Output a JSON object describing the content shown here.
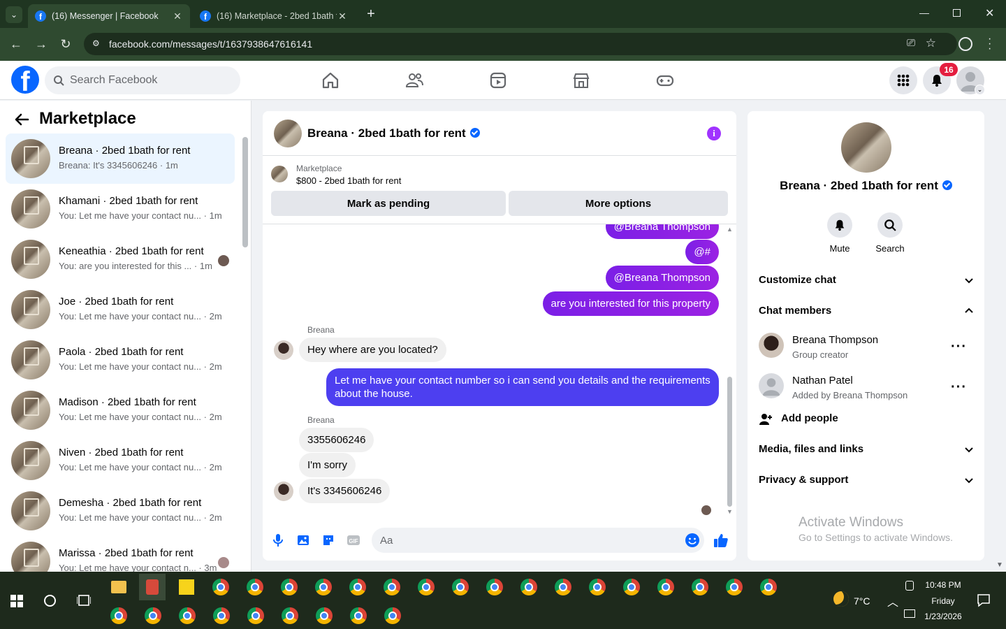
{
  "browser": {
    "tabs": [
      {
        "title": "(16) Messenger | Facebook",
        "active": true
      },
      {
        "title": "(16) Marketplace - 2bed 1bath f",
        "active": false
      }
    ],
    "url": "facebook.com/messages/t/1637938647616141"
  },
  "header": {
    "search_placeholder": "Search Facebook",
    "notification_count": "16"
  },
  "left": {
    "title": "Marketplace",
    "chats": [
      {
        "name": "Breana · 2bed 1bath for rent",
        "preview": "Breana: It's 3345606246 · 1m",
        "selected": true
      },
      {
        "name": "Khamani · 2bed 1bath for rent",
        "preview": "You: Let me have your contact nu...  · 1m"
      },
      {
        "name": "Keneathia · 2bed 1bath for rent",
        "preview": "You: are you interested for this ...  · 1m"
      },
      {
        "name": "Joe · 2bed 1bath for rent",
        "preview": "You: Let me have your contact nu...  · 2m"
      },
      {
        "name": "Paola · 2bed 1bath for rent",
        "preview": "You: Let me have your contact nu...  · 2m"
      },
      {
        "name": "Madison · 2bed 1bath for rent",
        "preview": "You: Let me have your contact nu...  · 2m"
      },
      {
        "name": "Niven · 2bed 1bath for rent",
        "preview": "You: Let me have your contact nu...  · 2m"
      },
      {
        "name": "Demesha · 2bed 1bath for rent",
        "preview": "You: Let me have your contact nu...  · 2m"
      },
      {
        "name": "Marissa · 2bed 1bath for rent",
        "preview": "You: Let me have your contact n...  · 3m"
      }
    ]
  },
  "chat": {
    "title": "Breana · 2bed 1bath for rent",
    "marketplace_label": "Marketplace",
    "listing": "$800 - 2bed 1bath for rent",
    "mark_pending": "Mark as pending",
    "more_options": "More options",
    "messages": {
      "m1": "@Breana Thompson",
      "m2": "@#",
      "m3": "@Breana Thompson",
      "m4": "are you interested for this property",
      "sender1": "Breana",
      "m5": "Hey where are you located?",
      "m6_line1": "Let me have your contact number so i can send you details and the requirements",
      "m6_line2": "about the house.",
      "sender2": "Breana",
      "m7": "3355606246",
      "m8": "I'm sorry",
      "m9": "It's 3345606246"
    },
    "composer_placeholder": "Aa"
  },
  "right": {
    "name": "Breana · 2bed 1bath for rent",
    "mute": "Mute",
    "search": "Search",
    "customize": "Customize chat",
    "chat_members": "Chat members",
    "members": [
      {
        "name": "Breana Thompson",
        "role": "Group creator"
      },
      {
        "name": "Nathan Patel",
        "role": "Added by Breana Thompson"
      }
    ],
    "add_people": "Add people",
    "media": "Media, files and links",
    "privacy": "Privacy & support",
    "watermark1": "Activate Windows",
    "watermark2": "Go to Settings to activate Windows."
  },
  "taskbar": {
    "weather": "7°C",
    "time": "10:48 PM",
    "day": "Friday",
    "date": "1/23/2026"
  },
  "colors": {
    "fb_blue": "#0866ff",
    "outgoing_purple": "#8a2be2",
    "outgoing_blue": "#4d3ff0",
    "badge_red": "#e41e3f"
  }
}
